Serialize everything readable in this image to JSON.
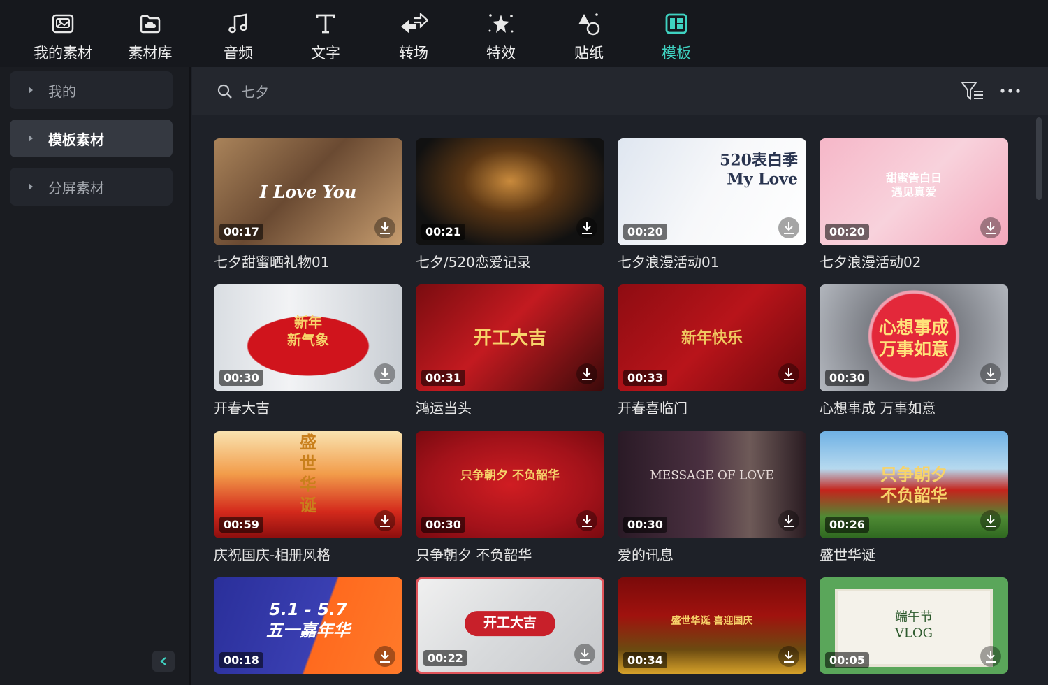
{
  "toolbar": {
    "tabs": [
      {
        "label": "我的素材",
        "icon": "image-icon"
      },
      {
        "label": "素材库",
        "icon": "cloud-folder-icon"
      },
      {
        "label": "音频",
        "icon": "music-note-icon"
      },
      {
        "label": "文字",
        "icon": "text-icon"
      },
      {
        "label": "转场",
        "icon": "transition-icon"
      },
      {
        "label": "特效",
        "icon": "sparkle-effect-icon"
      },
      {
        "label": "贴纸",
        "icon": "sticker-icon"
      },
      {
        "label": "模板",
        "icon": "template-icon",
        "active": true
      }
    ],
    "accent_color": "#3fd2c1"
  },
  "sidebar": {
    "items": [
      {
        "label": "我的"
      },
      {
        "label": "模板素材",
        "selected": true
      },
      {
        "label": "分屏素材"
      }
    ]
  },
  "search": {
    "value": "七夕"
  },
  "templates": [
    {
      "title": "七夕甜蜜晒礼物01",
      "duration": "00:17",
      "overlay": "I Love You"
    },
    {
      "title": "七夕/520恋爱记录",
      "duration": "00:21",
      "overlay": ""
    },
    {
      "title": "七夕浪漫活动01",
      "duration": "00:20",
      "overlay": "520表白季\nMy Love"
    },
    {
      "title": "七夕浪漫活动02",
      "duration": "00:20",
      "overlay": "甜蜜告白日\n遇见真爱"
    },
    {
      "title": "开春大吉",
      "duration": "00:30",
      "overlay": "新年\n新气象"
    },
    {
      "title": "鸿运当头",
      "duration": "00:31",
      "overlay": "开工大吉"
    },
    {
      "title": "开春喜临门",
      "duration": "00:33",
      "overlay": "新年快乐"
    },
    {
      "title": "心想事成 万事如意",
      "duration": "00:30",
      "overlay": "心想事成\n万事如意"
    },
    {
      "title": "庆祝国庆-相册风格",
      "duration": "00:59",
      "overlay": "盛世华诞"
    },
    {
      "title": "只争朝夕 不负韶华",
      "duration": "00:30",
      "overlay": "只争朝夕  不负韶华"
    },
    {
      "title": "爱的讯息",
      "duration": "00:30",
      "overlay": "MESSAGE OF LOVE"
    },
    {
      "title": "盛世华诞",
      "duration": "00:26",
      "overlay": "只争朝夕\n不负韶华"
    },
    {
      "title": "",
      "duration": "00:18",
      "overlay": "5.1 - 5.7\n五一嘉年华"
    },
    {
      "title": "",
      "duration": "00:22",
      "overlay": "开工大吉"
    },
    {
      "title": "",
      "duration": "00:34",
      "overlay": "盛世华诞 喜迎国庆"
    },
    {
      "title": "",
      "duration": "00:05",
      "overlay": "端午节\nVLOG"
    }
  ]
}
